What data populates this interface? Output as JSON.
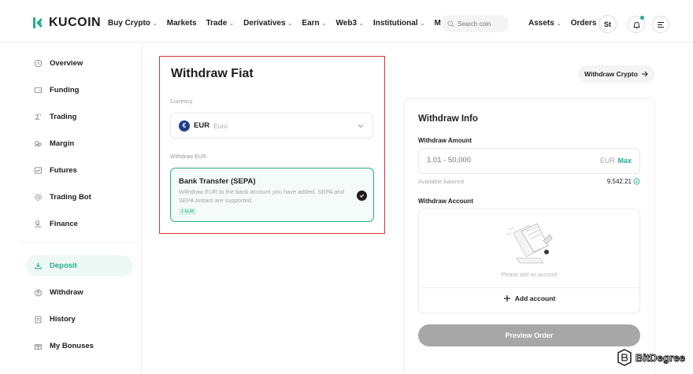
{
  "brand": {
    "name": "KUCOIN",
    "accent": "#24ae8f"
  },
  "nav": {
    "items": [
      {
        "label": "Buy Crypto",
        "dropdown": true
      },
      {
        "label": "Markets",
        "dropdown": false
      },
      {
        "label": "Trade",
        "dropdown": true
      },
      {
        "label": "Derivatives",
        "dropdown": true
      },
      {
        "label": "Earn",
        "dropdown": true
      },
      {
        "label": "Web3",
        "dropdown": true
      },
      {
        "label": "Institutional",
        "dropdown": true
      },
      {
        "label": "More",
        "dropdown": true
      }
    ],
    "search_placeholder": "Search coin",
    "right": [
      {
        "label": "Assets",
        "dropdown": true
      },
      {
        "label": "Orders",
        "dropdown": true
      }
    ],
    "avatar": "St"
  },
  "sidebar": {
    "items": [
      {
        "label": "Overview",
        "icon": "clock-icon"
      },
      {
        "label": "Funding",
        "icon": "wallet-icon"
      },
      {
        "label": "Trading",
        "icon": "coins-icon"
      },
      {
        "label": "Margin",
        "icon": "margin-icon"
      },
      {
        "label": "Futures",
        "icon": "chart-icon"
      },
      {
        "label": "Trading Bot",
        "icon": "gear-icon"
      },
      {
        "label": "Finance",
        "icon": "finance-icon"
      },
      {
        "label": "Deposit",
        "icon": "download-icon",
        "active": true
      },
      {
        "label": "Withdraw",
        "icon": "upload-icon"
      },
      {
        "label": "History",
        "icon": "clipboard-icon"
      },
      {
        "label": "My Bonuses",
        "icon": "gift-icon"
      }
    ]
  },
  "withdraw": {
    "title": "Withdraw Fiat",
    "currency_label": "Currency",
    "currency": {
      "code": "EUR",
      "name": "Euro",
      "symbol": "€"
    },
    "method_label": "Withdraw EUR",
    "method": {
      "title": "Bank Transfer (SEPA)",
      "description": "Withdraw EUR to the bank account you have added. SEPA and SEPA Instant are supported.",
      "tag": "1 EUR"
    }
  },
  "crypto_button": "Withdraw Crypto",
  "info": {
    "title": "Withdraw Info",
    "amount_label": "Withdraw Amount",
    "amount_placeholder": "1.01 - 50,000",
    "amount_unit": "EUR",
    "max_label": "Max",
    "available_label": "Available balance",
    "available_value": "9,542.21",
    "account_label": "Withdraw Account",
    "account_empty": "Please add an account",
    "add_account": "Add account",
    "preview_button": "Preview Order"
  },
  "watermark": "BitDegree"
}
